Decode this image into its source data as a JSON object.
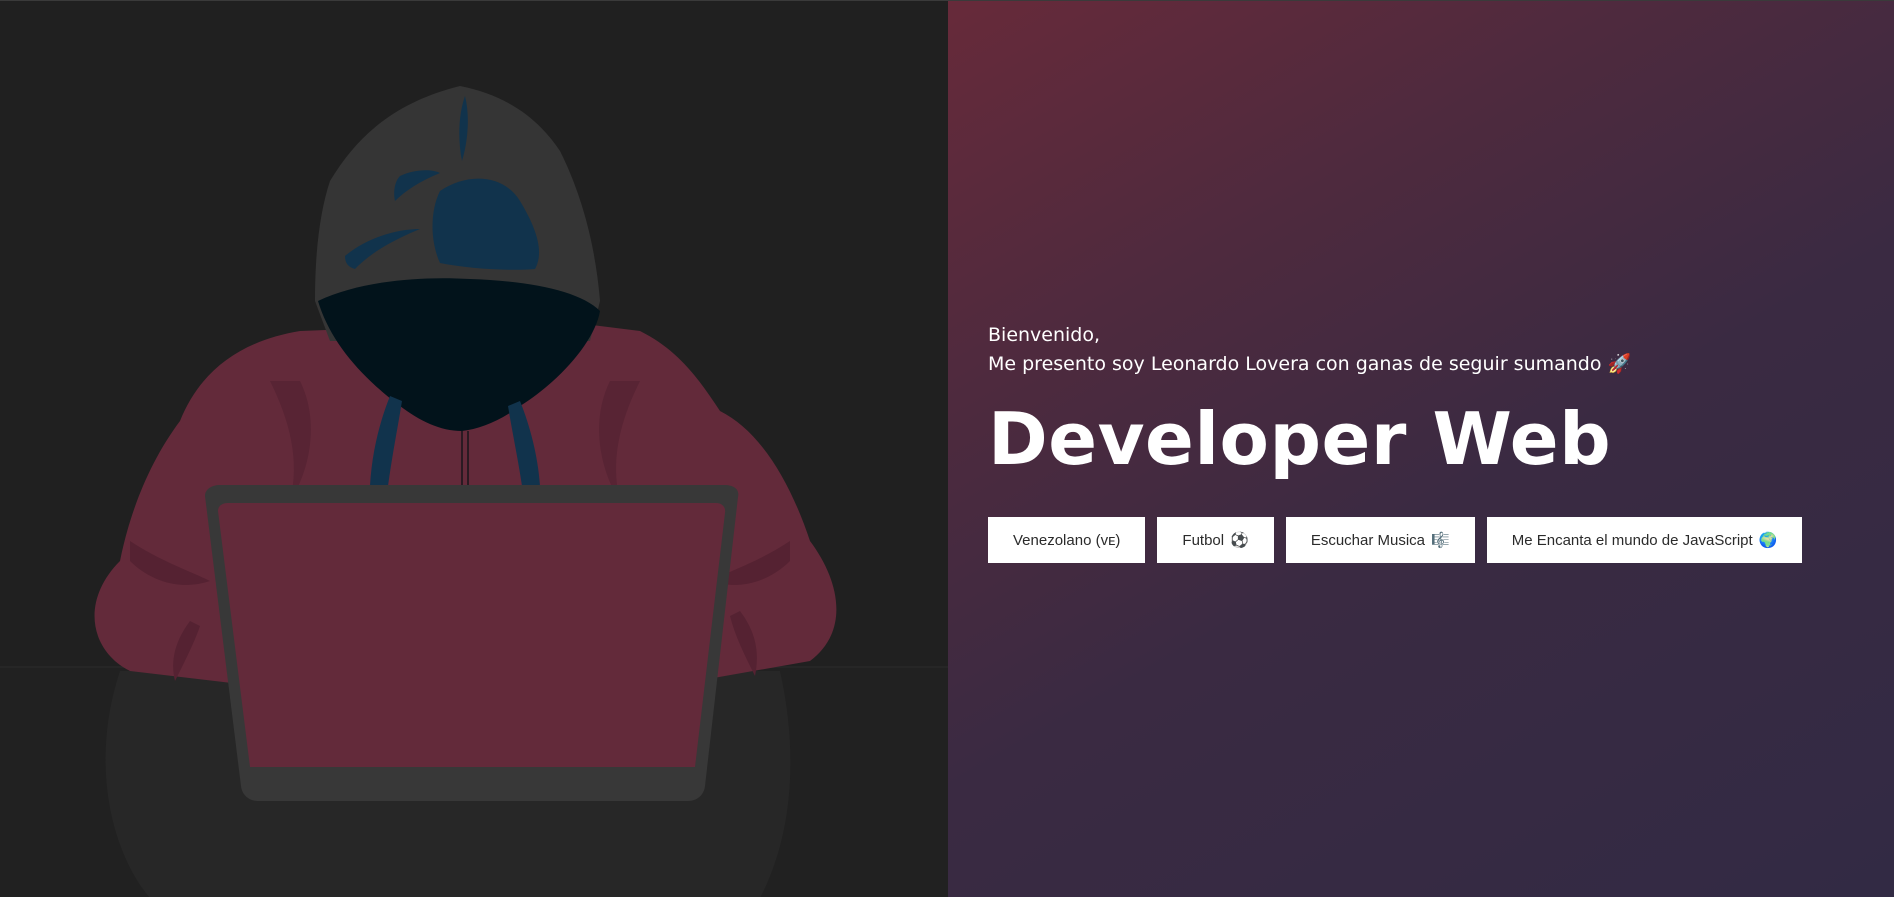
{
  "hero": {
    "greeting_line1": "Bienvenido,",
    "greeting_line2": "Me presento soy Leonardo Lovera con ganas de seguir sumando",
    "greeting_emoji": "🚀",
    "title": "Developer Web"
  },
  "tags": [
    {
      "label": "Venezolano (ᴠᴇ)",
      "emoji": ""
    },
    {
      "label": "Futbol",
      "emoji": "⚽"
    },
    {
      "label": "Escuchar Musica",
      "emoji": "🎼"
    },
    {
      "label": "Me Encanta el mundo de JavaScript",
      "emoji": "🌍"
    }
  ],
  "colors": {
    "left_bg": "#202020",
    "hoodie": "#632a3a",
    "hood": "#353535",
    "face": "#02131b",
    "accent_blue": "#11334c",
    "laptop": "#383838",
    "gradient_start": "#672a3a",
    "gradient_end": "#322a44"
  },
  "illustration": {
    "icon": "hooded-hacker-laptop-illustration"
  }
}
